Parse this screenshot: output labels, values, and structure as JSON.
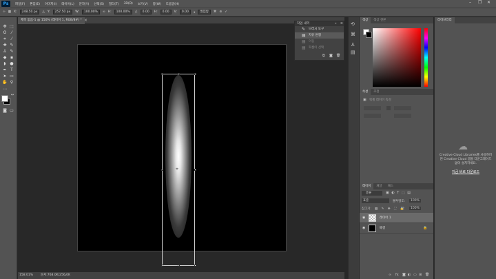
{
  "app": {
    "logo": "Ps"
  },
  "menu": [
    "파일(F)",
    "편집(E)",
    "이미지(I)",
    "레이어(L)",
    "문자(Y)",
    "선택(S)",
    "필터(T)",
    "3D(D)",
    "보기(V)",
    "창(W)",
    "도움말(H)"
  ],
  "window_controls": {
    "minimize": "–",
    "restore": "❐",
    "close": "✕"
  },
  "options": {
    "x_label": "X:",
    "x_value": "248.50 px",
    "y_label": "Y:",
    "y_value": "257.50 px",
    "w_label": "W:",
    "w_value": "100.00%",
    "h_label": "H:",
    "h_value": "100.00%",
    "angle_value": "0.00",
    "h_skew_label": "H:",
    "h_skew_value": "0.00",
    "v_skew_label": "V:",
    "v_skew_value": "0.00",
    "interp_value": "쌍입방"
  },
  "document": {
    "tab_title": "제목 없음-1 @ 150% (레이어 1, RGB/8#) *",
    "status_zoom": "158.01%",
    "status_doc": "문서:768.0K/256.0K"
  },
  "history": {
    "tabs": [
      "작업 내역"
    ],
    "items": [
      {
        "label": "브러시 도구",
        "state": "normal"
      },
      {
        "label": "자유 변형",
        "state": "active"
      },
      {
        "label": "이동",
        "state": "dim"
      },
      {
        "label": "픽셀이 선택",
        "state": "dim"
      }
    ]
  },
  "color_panel": {
    "tabs": [
      "색상",
      "색상 견본"
    ],
    "fg_color": "#ffffff",
    "bg_color": "#000000"
  },
  "properties": {
    "tabs": [
      "속성",
      "조정"
    ],
    "title": "픽셀 레이어 속성"
  },
  "layers": {
    "tabs": [
      "레이어",
      "채널",
      "패스"
    ],
    "kind_label": "종류",
    "blend_mode": "표준",
    "opacity_label": "불투명도:",
    "opacity_value": "100%",
    "lock_label": "잠그기:",
    "fill_label": "칠:",
    "fill_value": "100%",
    "items": [
      {
        "name": "레이어 1",
        "active": true
      },
      {
        "name": "배경",
        "active": false
      }
    ]
  },
  "libraries": {
    "tab": "라이브러리",
    "message": "Creative Cloud Libraries를 사용하려면 Creative Cloud 앱을 다운그레이드 없이 설치하세요.",
    "link": "지금 바로 다운로드"
  }
}
